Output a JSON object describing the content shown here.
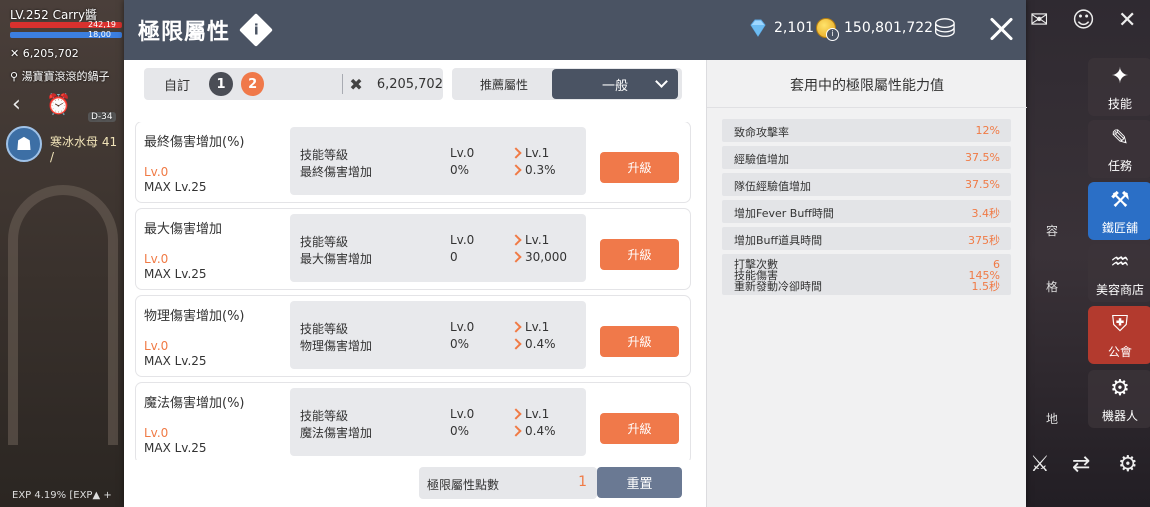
{
  "hud": {
    "level": "LV.252 Carry醬",
    "hp": "242,19",
    "mp": "18,00",
    "cp_value": "6,205,702",
    "location": "湯寶寶滾滾的鍋子",
    "tag": "寒冰水母 41 /",
    "d_badge": "D-34",
    "exp": "EXP 4.19%",
    "exp2": "[EXP▲ +"
  },
  "right_hud": {
    "items": [
      "技能",
      "任務",
      "鐵匠舖",
      "美容商店",
      "公會",
      "機器人"
    ],
    "partials": [
      "容",
      "格",
      "地"
    ]
  },
  "modal": {
    "title": "極限屬性",
    "info_icon": "i",
    "gems": "2,101",
    "coins": "150,801,722"
  },
  "filter": {
    "preset_label": "自訂",
    "preset_1": "1",
    "preset_2": "2",
    "combat_power": "6,205,702",
    "recommend_label": "推薦屬性",
    "recommend_value": "一般"
  },
  "skills": [
    {
      "name": "最終傷害增加(%)",
      "lv": "Lv.0",
      "max": "MAX Lv.25",
      "label1": "技能等級",
      "label2": "最終傷害增加",
      "cur1": "Lv.0",
      "cur2": "0%",
      "next1": "Lv.1",
      "next2": "0.3%",
      "button": "升級"
    },
    {
      "name": "最大傷害增加",
      "lv": "Lv.0",
      "max": "MAX Lv.25",
      "label1": "技能等級",
      "label2": "最大傷害增加",
      "cur1": "Lv.0",
      "cur2": "0",
      "next1": "Lv.1",
      "next2": "30,000",
      "button": "升級"
    },
    {
      "name": "物理傷害增加(%)",
      "lv": "Lv.0",
      "max": "MAX Lv.25",
      "label1": "技能等級",
      "label2": "物理傷害增加",
      "cur1": "Lv.0",
      "cur2": "0%",
      "next1": "Lv.1",
      "next2": "0.4%",
      "button": "升級"
    },
    {
      "name": "魔法傷害增加(%)",
      "lv": "Lv.0",
      "max": "MAX Lv.25",
      "label1": "技能等級",
      "label2": "魔法傷害增加",
      "cur1": "Lv.0",
      "cur2": "0%",
      "next1": "Lv.1",
      "next2": "0.4%",
      "button": "升級"
    }
  ],
  "footer": {
    "points_label": "極限屬性點數",
    "points_value": "1",
    "reset_label": "重置"
  },
  "stats": {
    "title": "套用中的極限屬性能力值",
    "rows": [
      {
        "name": "致命攻擊率",
        "value": "12%"
      },
      {
        "name": "經驗值增加",
        "value": "37.5%"
      },
      {
        "name": "隊伍經驗值增加",
        "value": "37.5%"
      },
      {
        "name": "增加Fever Buff時間",
        "value": "3.4秒"
      },
      {
        "name": "增加Buff道具時間",
        "value": "375秒"
      }
    ],
    "multi": [
      {
        "name": "打擊次數",
        "value": "6"
      },
      {
        "name": "技能傷害",
        "value": "145%"
      },
      {
        "name": "重新發動冷卻時間",
        "value": "1.5秒"
      }
    ]
  },
  "colors": {
    "header": "#4a5363",
    "accent": "#f0794a",
    "reset": "#6a7993"
  }
}
